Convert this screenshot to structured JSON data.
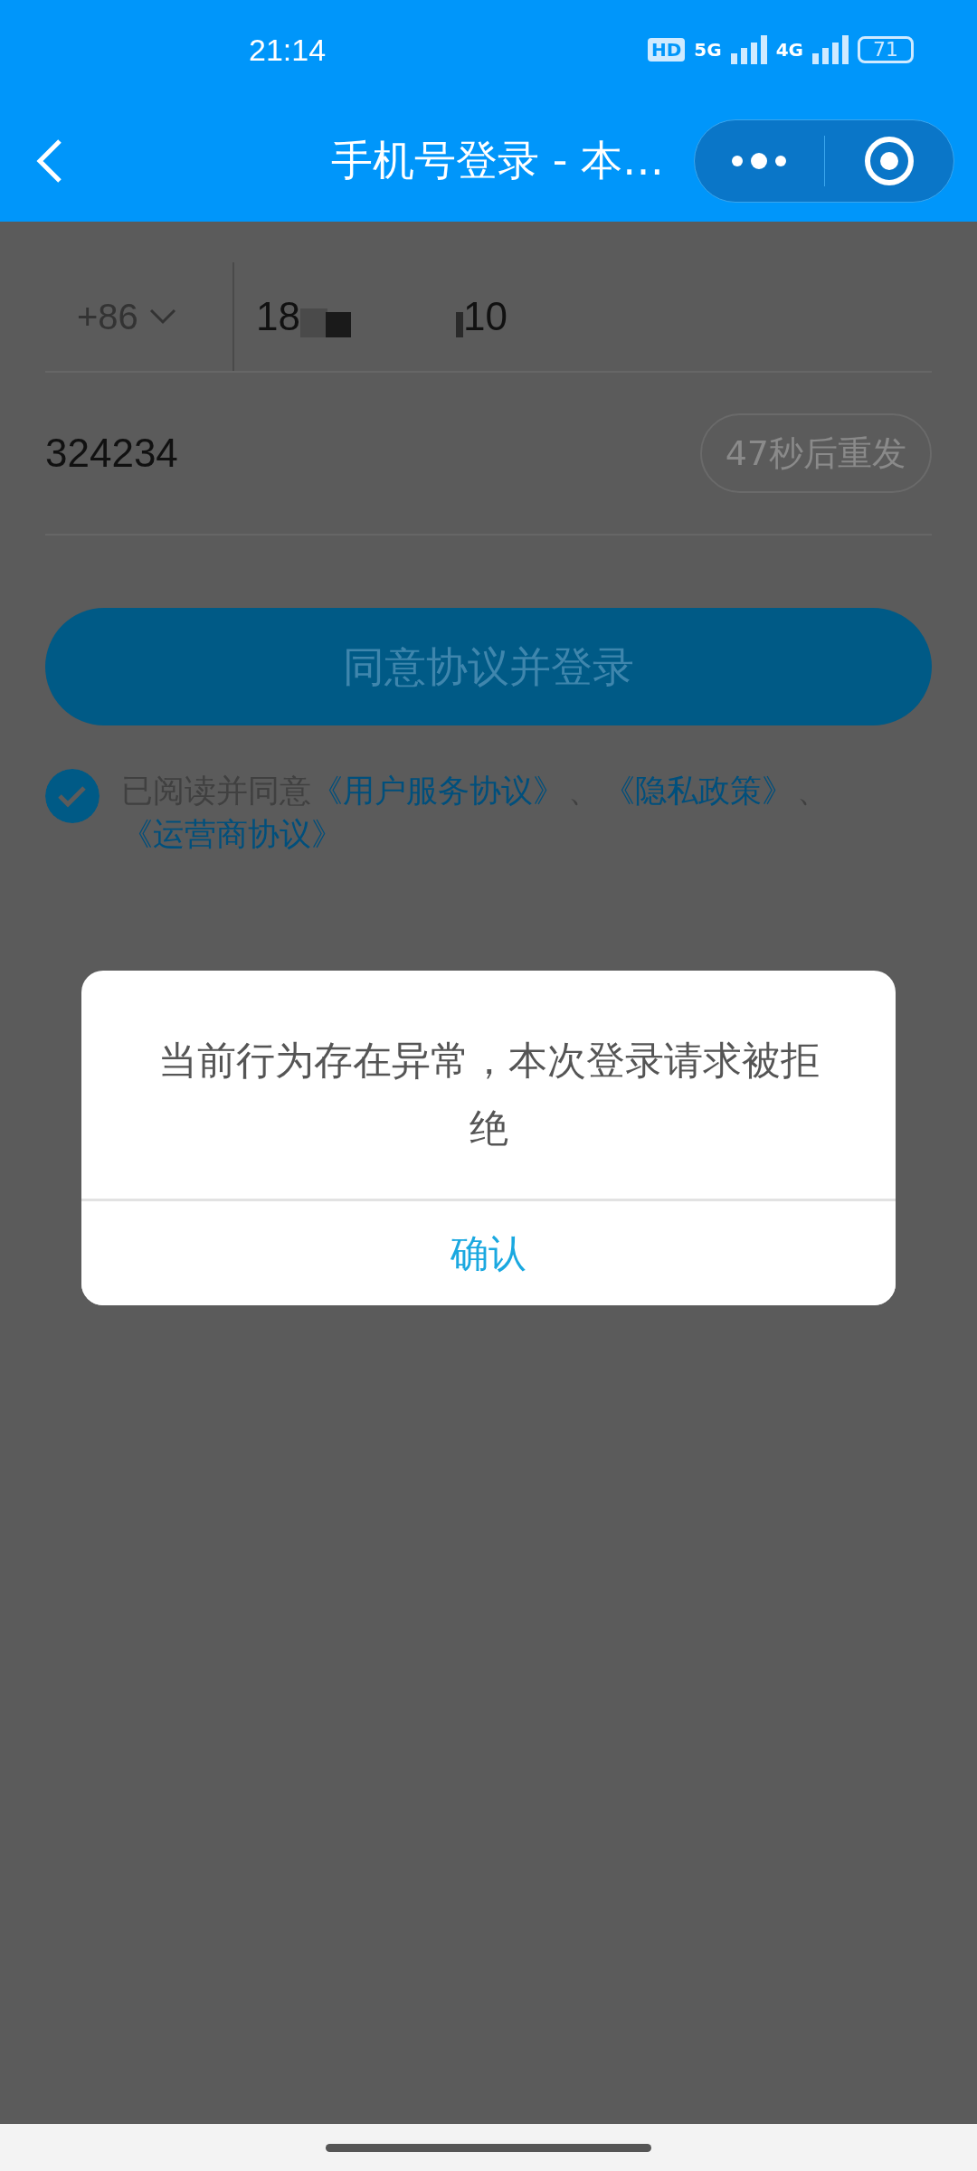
{
  "status_bar": {
    "time": "21:14",
    "hd": "HD",
    "network_1": "5G",
    "network_2": "4G",
    "battery": "71"
  },
  "header": {
    "title": "手机号登录 - 本…"
  },
  "phone": {
    "country_code": "+86",
    "number_start": "18",
    "number_end": "10"
  },
  "code": {
    "value": "324234",
    "resend": "47秒后重发",
    "resend_disabled": true
  },
  "login_button": {
    "label": "同意协议并登录"
  },
  "agreement": {
    "checked": true,
    "intro": "已阅读并同意",
    "links": [
      {
        "text": "《用户服务协议》",
        "separator": "、"
      },
      {
        "text": "《隐私政策》",
        "separator": "、"
      },
      {
        "text": "《运营商协议》"
      }
    ]
  },
  "dialog": {
    "message": "当前行为存在异常，本次登录请求被拒绝",
    "confirm": "确认"
  }
}
